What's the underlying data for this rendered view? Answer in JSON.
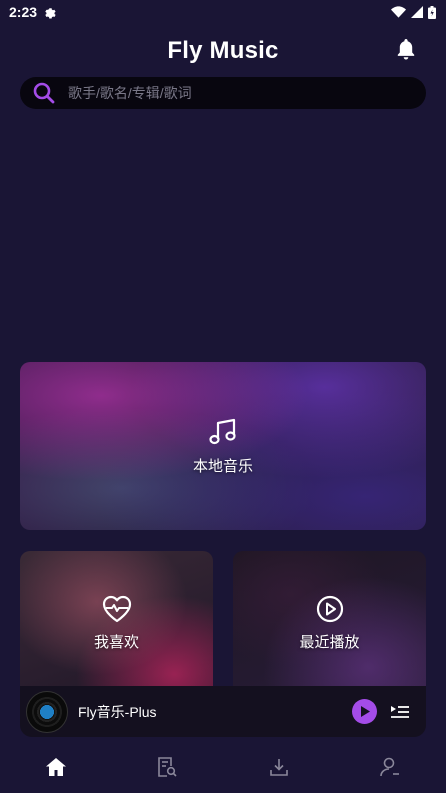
{
  "status_bar": {
    "time": "2:23",
    "icons": [
      "settings-gear-icon",
      "wifi-icon",
      "signal-icon",
      "battery-icon"
    ]
  },
  "header": {
    "title": "Fly Music",
    "notification_icon": "bell-icon"
  },
  "search": {
    "placeholder": "歌手/歌名/专辑/歌词",
    "icon": "search-icon"
  },
  "cards": {
    "local": {
      "label": "本地音乐",
      "icon": "music-note-icon"
    },
    "favorites": {
      "label": "我喜欢",
      "icon": "heartbeat-icon"
    },
    "recent": {
      "label": "最近播放",
      "icon": "play-circle-icon"
    }
  },
  "player": {
    "song_title": "Fly音乐-Plus",
    "play_icon": "play-icon",
    "queue_icon": "playlist-icon"
  },
  "tabbar": {
    "tabs": [
      {
        "name": "home",
        "icon": "home-icon",
        "active": true
      },
      {
        "name": "search-library",
        "icon": "document-search-icon",
        "active": false
      },
      {
        "name": "downloads",
        "icon": "download-icon",
        "active": false
      },
      {
        "name": "profile",
        "icon": "user-icon",
        "active": false
      }
    ]
  },
  "colors": {
    "background": "#1a1535",
    "accent": "#a44ce8",
    "search_bg": "#08060f"
  }
}
